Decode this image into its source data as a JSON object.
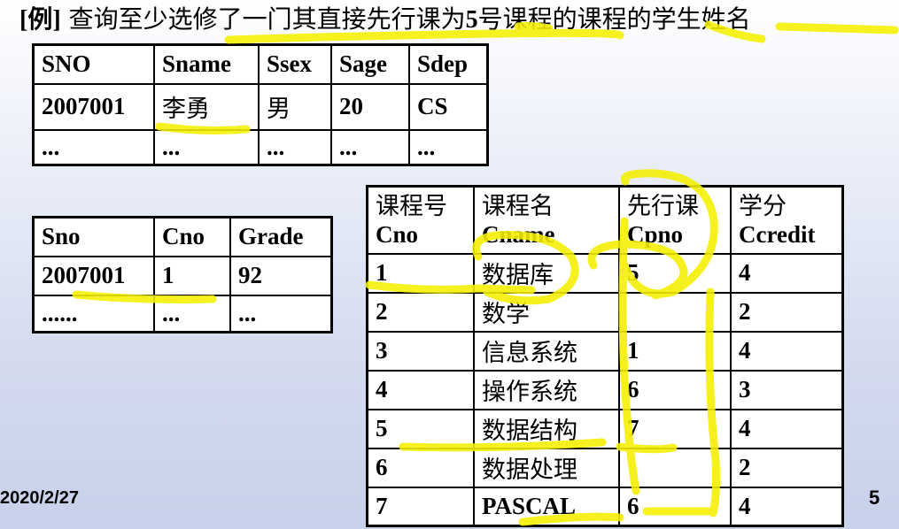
{
  "title": {
    "tag": "[例]",
    "text_before": "查询至少选修了一门其直接先行课为",
    "number": "5",
    "text_after": "号课程的课程的学生姓名"
  },
  "student_table": {
    "headers": [
      "SNO",
      "Sname",
      "Ssex",
      "Sage",
      "Sdep"
    ],
    "rows": [
      [
        "2007001",
        "李勇",
        "男",
        "20",
        "CS"
      ],
      [
        "...",
        "...",
        "...",
        "...",
        "..."
      ]
    ]
  },
  "sc_table": {
    "headers": [
      "Sno",
      "Cno",
      "Grade"
    ],
    "rows": [
      [
        "2007001",
        "1",
        "92"
      ],
      [
        "......",
        "...",
        "..."
      ]
    ]
  },
  "course_table": {
    "headers": [
      {
        "cn": "课程号",
        "en": "Cno"
      },
      {
        "cn": "课程名",
        "en": "Cname"
      },
      {
        "cn": "先行课",
        "en": "Cpno"
      },
      {
        "cn": "学分",
        "en": "Ccredit"
      }
    ],
    "rows": [
      [
        "1",
        "数据库",
        "5",
        "4"
      ],
      [
        "2",
        "数学",
        "",
        "2"
      ],
      [
        "3",
        "信息系统",
        "1",
        "4"
      ],
      [
        "4",
        "操作系统",
        "6",
        "3"
      ],
      [
        "5",
        "数据结构",
        "7",
        "4"
      ],
      [
        "6",
        "数据处理",
        "",
        "2"
      ],
      [
        "7",
        "PASCAL",
        "6",
        "4"
      ]
    ]
  },
  "footer": {
    "date": "2020/2/27",
    "page_number": "5"
  },
  "highlight_color": "#f5f000"
}
